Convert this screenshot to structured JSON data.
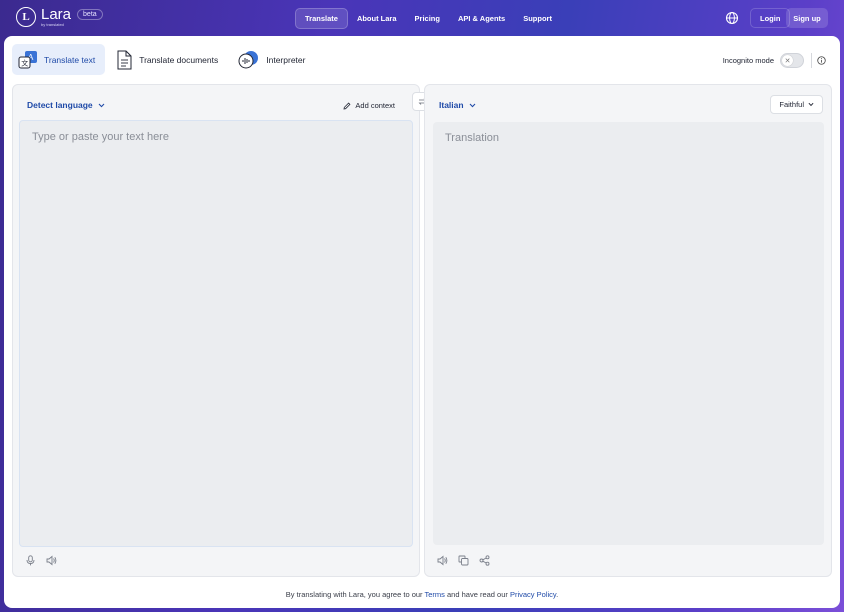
{
  "brand": {
    "name": "Lara",
    "sub": "by translated",
    "badge": "beta",
    "logo_letter": "L"
  },
  "nav": {
    "items": [
      {
        "label": "Translate",
        "active": true
      },
      {
        "label": "About Lara"
      },
      {
        "label": "Pricing"
      },
      {
        "label": "API & Agents"
      },
      {
        "label": "Support"
      }
    ],
    "language_icon": "globe-icon",
    "login_label": "Login",
    "signup_label": "Sign up"
  },
  "modes": [
    {
      "label": "Translate text",
      "icon": "translate-text-icon",
      "active": true
    },
    {
      "label": "Translate documents",
      "icon": "document-icon"
    },
    {
      "label": "Interpreter",
      "icon": "interpreter-icon"
    }
  ],
  "incognito": {
    "label": "Incognito mode",
    "enabled": false
  },
  "source": {
    "language": "Detect language",
    "add_context_label": "Add context",
    "placeholder": "Type or paste your text here",
    "value": ""
  },
  "target": {
    "language": "Italian",
    "style": "Faithful",
    "placeholder": "Translation"
  },
  "footer": {
    "prefix": "By translating with Lara, you agree to our ",
    "terms": "Terms",
    "middle": " and have read our ",
    "privacy": "Privacy Policy",
    "suffix": "."
  },
  "colors": {
    "accent": "#1f4aa8",
    "brand_gradient_start": "#3b2a8f",
    "brand_gradient_end": "#7b4fd8"
  }
}
